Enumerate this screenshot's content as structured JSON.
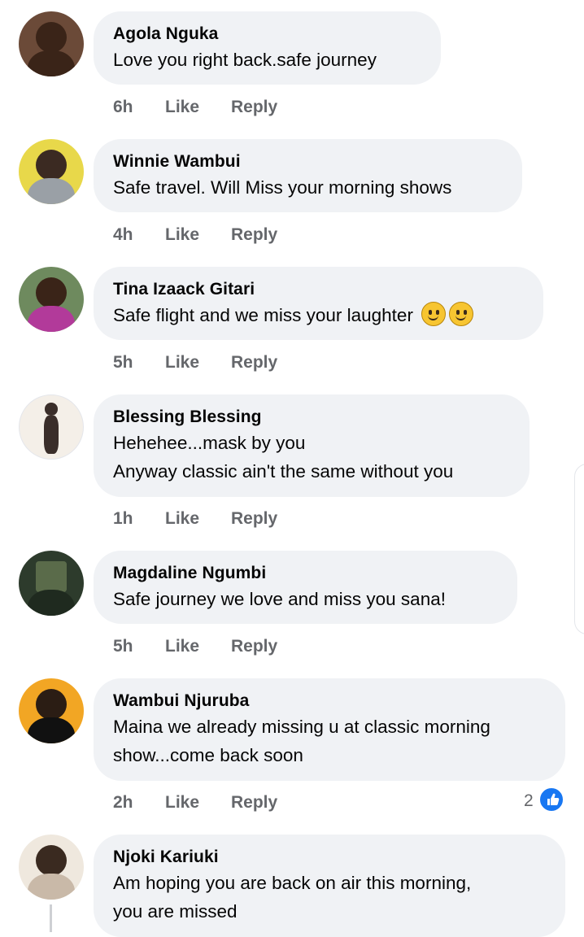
{
  "comments": [
    {
      "name": "Agola Nguka",
      "text": [
        "Love you right back.safe journey"
      ],
      "time": "6h",
      "avatar_colors": [
        "#3a2418",
        "#6b4a38"
      ]
    },
    {
      "name": "Winnie Wambui",
      "text": [
        "Safe travel. Will Miss your morning shows"
      ],
      "time": "4h",
      "avatar_colors": [
        "#e8d84a",
        "#3b2a22"
      ]
    },
    {
      "name": "Tina Izaack Gitari",
      "text": [
        "Safe flight and we miss your laughter"
      ],
      "time": "5h",
      "avatar_colors": [
        "#6e8a5e",
        "#b23a9a"
      ]
    },
    {
      "name": "Blessing Blessing",
      "text": [
        "Hehehee...mask by you",
        "Anyway classic ain't the same without you"
      ],
      "time": "1h",
      "avatar_colors": [
        "#f4efe8",
        "#3a2e2a"
      ]
    },
    {
      "name": "Magdaline Ngumbi",
      "text": [
        "Safe journey we love and miss you sana!"
      ],
      "time": "5h",
      "avatar_colors": [
        "#2d3b2c",
        "#5a6b4a"
      ]
    },
    {
      "name": "Wambui Njuruba",
      "text": [
        "Maina we already missing u at classic morning",
        "show...come back soon"
      ],
      "time": "2h",
      "avatar_colors": [
        "#f2a624",
        "#2b1d14"
      ]
    },
    {
      "name": "Njoki Kariuki",
      "text": [
        "Am hoping you are back on air this morning,",
        "you are missed"
      ],
      "time": "",
      "avatar_colors": [
        "#efe8de",
        "#3a2a20"
      ]
    }
  ],
  "actions": {
    "like": "Like",
    "reply": "Reply"
  },
  "reactions": {
    "count": "2",
    "icon": "thumbs-up-icon",
    "color": "#1877f2"
  }
}
